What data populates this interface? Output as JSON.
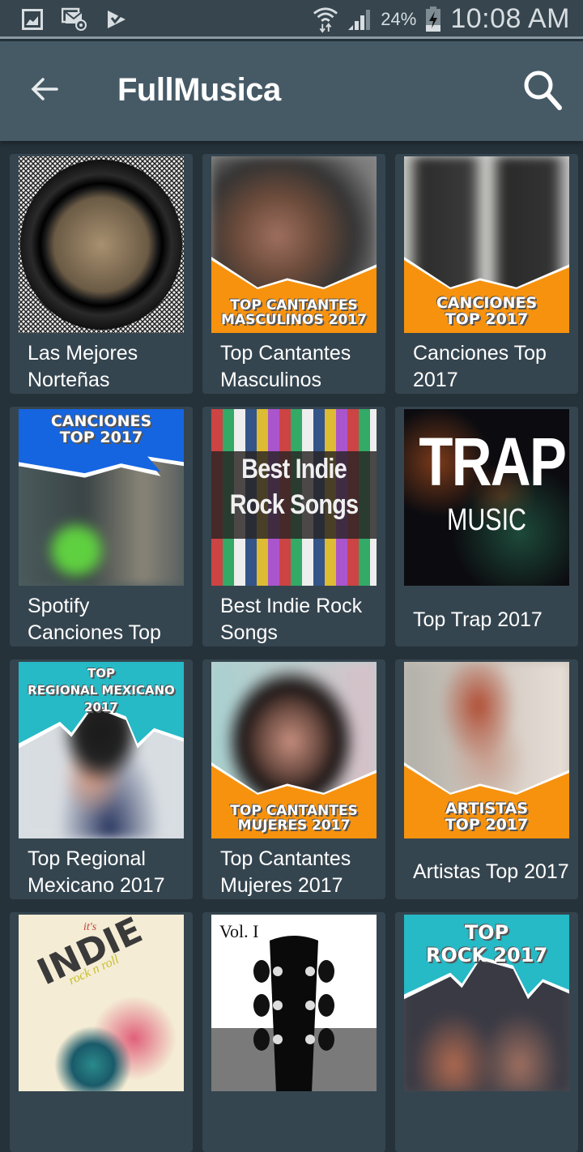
{
  "status_bar": {
    "left_icons": [
      "gallery-icon",
      "email-sync-icon",
      "play-store-check-icon"
    ],
    "right_icons": [
      "wifi-icon",
      "signal-icon",
      "battery-charging-icon"
    ],
    "battery_percent": "24%",
    "time": "10:08 AM"
  },
  "app_bar": {
    "title": "FullMusica",
    "back_icon": "arrow-back-icon",
    "search_icon": "search-icon"
  },
  "colors": {
    "status_bar_bg": "#36454e",
    "app_bar_bg": "#465a66",
    "page_bg": "#26323a",
    "card_bg": "#35454f",
    "orange_banner": "#f7920e",
    "blue_banner": "#1565e0",
    "teal_banner": "#26b9c6"
  },
  "playlists": [
    {
      "label": "Las Mejores Norteñas",
      "art": "vinyl-record-art"
    },
    {
      "label": "Top Cantantes Masculinos",
      "art_text": [
        "TOP CANTANTES",
        "MASCULINOS 2017"
      ]
    },
    {
      "label": "Canciones Top 2017",
      "art_text": [
        "CANCIONES",
        "TOP 2017"
      ]
    },
    {
      "label": "Spotify Canciones Top",
      "art_text": [
        "CANCIONES",
        "TOP 2017"
      ]
    },
    {
      "label": "Best Indie Rock Songs",
      "art_text": [
        "Best Indie",
        "Rock Songs"
      ]
    },
    {
      "label": "Top Trap 2017",
      "art_text": [
        "TRAP",
        "MUSIC"
      ]
    },
    {
      "label": "Top Regional Mexicano 2017",
      "art_text": [
        "TOP",
        "REGIONAL MEXICANO",
        "2017"
      ]
    },
    {
      "label": "Top Cantantes Mujeres 2017",
      "art_text": [
        "TOP CANTANTES",
        "MUJERES 2017"
      ]
    },
    {
      "label": "Artistas Top 2017",
      "art_text": [
        "ARTISTAS",
        "TOP 2017"
      ]
    },
    {
      "label": "",
      "art_text": [
        "it's",
        "INDIE",
        "rock n roll"
      ]
    },
    {
      "label": "",
      "art_text": [
        "Vol. I"
      ]
    },
    {
      "label": "",
      "art_text": [
        "TOP",
        "ROCK 2017"
      ]
    }
  ]
}
